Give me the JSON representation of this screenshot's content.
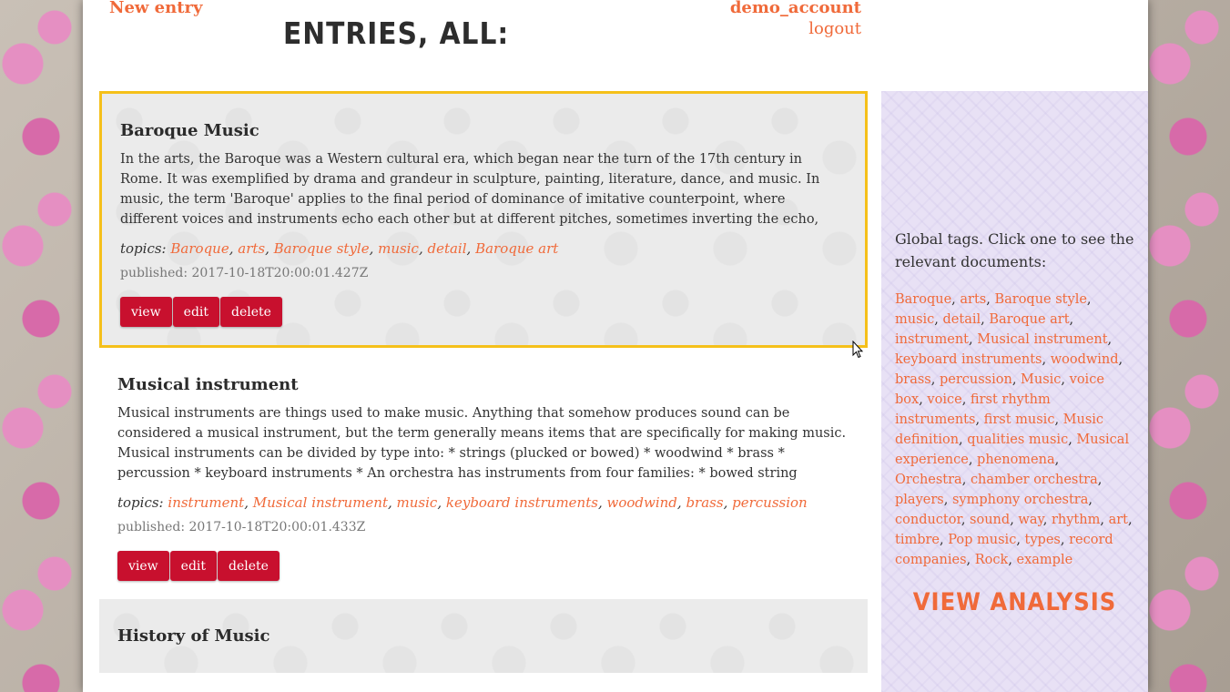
{
  "header": {
    "new_entry": "New entry",
    "title": "ENTRIES, ALL:",
    "account_name": "demo_account",
    "logout": "logout"
  },
  "entries": [
    {
      "title": "Baroque Music",
      "description": "In the arts, the Baroque was a Western cultural era, which began near the turn of the 17th century in Rome. It was exemplified by drama and grandeur in sculpture, painting, literature, dance, and music. In music, the term 'Baroque' applies to the final period of dominance of imitative counterpoint, where different voices and instruments echo each other but at different pitches, sometimes inverting the echo, and even reversing thematic…",
      "topics_label": "topics:",
      "topics": [
        "Baroque",
        "arts",
        "Baroque style",
        "music",
        "detail",
        "Baroque art"
      ],
      "published": "published: 2017-10-18T20:00:01.427Z",
      "buttons": [
        "view",
        "edit",
        "delete"
      ]
    },
    {
      "title": "Musical instrument",
      "description": "Musical instruments are things used to make music. Anything that somehow produces sound can be considered a musical instrument, but the term generally means items that are specifically for making music. Musical instruments can be divided by type into: * strings (plucked or bowed) * woodwind * brass * percussion * keyboard instruments * An orchestra has instruments from four families: * bowed string instruments (e.g. violin) * woodwi…",
      "topics_label": "topics:",
      "topics": [
        "instrument",
        "Musical instrument",
        "music",
        "keyboard instruments",
        "woodwind",
        "brass",
        "percussion"
      ],
      "published": "published: 2017-10-18T20:00:01.433Z",
      "buttons": [
        "view",
        "edit",
        "delete"
      ]
    },
    {
      "title": "History of Music"
    }
  ],
  "sidebar": {
    "global_tags_label": "Global tags. Click one to see the relevant documents:",
    "tags": [
      "Baroque",
      "arts",
      "Baroque style",
      "music",
      "detail",
      "Baroque art",
      "instrument",
      "Musical instrument",
      "keyboard instruments",
      "woodwind",
      "brass",
      "percussion",
      "Music",
      "voice box",
      "voice",
      "first rhythm instruments",
      "first music",
      "Music definition",
      "qualities music",
      "Musical experience",
      "phenomena",
      "Orchestra",
      "chamber orchestra",
      "players",
      "symphony orchestra",
      "conductor",
      "sound",
      "way",
      "rhythm",
      "art",
      "timbre",
      "Pop music",
      "types",
      "record companies",
      "Rock",
      "example"
    ],
    "view_analysis": "VIEW ANALYSIS"
  },
  "colors": {
    "accent": "#f06a3a",
    "button": "#c8102e",
    "selected_border": "#f5c01a",
    "sidebar_bg": "#e8e1f5"
  }
}
